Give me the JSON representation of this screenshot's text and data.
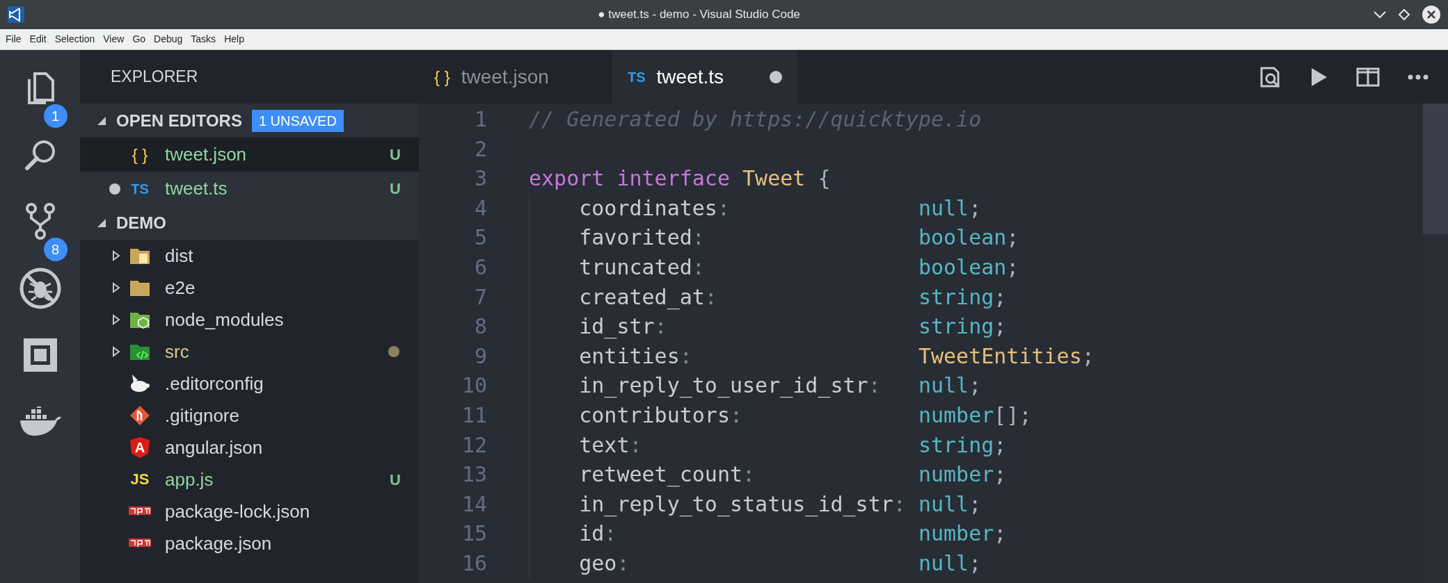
{
  "window": {
    "title": "● tweet.ts - demo - Visual Studio Code"
  },
  "menu": [
    "File",
    "Edit",
    "Selection",
    "View",
    "Go",
    "Debug",
    "Tasks",
    "Help"
  ],
  "activity_bar": [
    {
      "kind": "files",
      "badge": "1"
    },
    {
      "kind": "search"
    },
    {
      "kind": "source-control",
      "badge": "8"
    },
    {
      "kind": "no-debug"
    },
    {
      "kind": "extensions"
    },
    {
      "kind": "docker"
    }
  ],
  "sidebar": {
    "title": "EXPLORER",
    "open_editors": {
      "title": "OPEN EDITORS",
      "badge": "1 UNSAVED",
      "expanded": true,
      "items": [
        {
          "name": "tweet.json",
          "kind": "json",
          "icon_text": "{ }",
          "dirty": false,
          "selected": false,
          "status": "U"
        },
        {
          "name": "tweet.ts",
          "kind": "ts",
          "icon_text": "TS",
          "dirty": true,
          "selected": true,
          "status": "U"
        }
      ]
    },
    "project": {
      "title": "DEMO",
      "expanded": true,
      "items": [
        {
          "name": "dist",
          "kind": "folder-dist",
          "expanded": false,
          "modified": false
        },
        {
          "name": "e2e",
          "kind": "folder",
          "expanded": false,
          "modified": false
        },
        {
          "name": "node_modules",
          "kind": "folder-node",
          "expanded": false,
          "modified": false
        },
        {
          "name": "src",
          "kind": "folder-src",
          "expanded": false,
          "modified": true
        },
        {
          "name": ".editorconfig",
          "kind": "editorconfig",
          "modified": false
        },
        {
          "name": ".gitignore",
          "kind": "git",
          "modified": false
        },
        {
          "name": "angular.json",
          "kind": "angular",
          "icon_text": "A",
          "modified": false
        },
        {
          "name": "app.js",
          "kind": "js",
          "icon_text": "JS",
          "modified": false,
          "status": "U"
        },
        {
          "name": "package-lock.json",
          "kind": "npm",
          "modified": false
        },
        {
          "name": "package.json",
          "kind": "npm",
          "modified": false
        }
      ]
    }
  },
  "tabs": [
    {
      "label": "tweet.json",
      "kind": "json",
      "icon_text": "{ }",
      "selected": false,
      "dirty": false
    },
    {
      "label": "tweet.ts",
      "kind": "ts",
      "icon_text": "TS",
      "selected": true,
      "dirty": true
    }
  ],
  "editor": {
    "lines": [
      {
        "number": "1",
        "kind": "plain",
        "tokens": [
          {
            "kind": "comment",
            "text": "// Generated by https://quicktype.io"
          }
        ]
      },
      {
        "number": "2",
        "kind": "blank"
      },
      {
        "number": "3",
        "kind": "plain",
        "tokens": [
          {
            "kind": "keyword",
            "text": "export"
          },
          {
            "kind": "keyword",
            "text": "interface"
          },
          {
            "kind": "class",
            "text": "Tweet"
          },
          {
            "kind": "punct",
            "text": "{"
          }
        ]
      },
      {
        "number": "4",
        "kind": "field",
        "tokens": [
          {
            "kind": "prop",
            "text": "coordinates"
          },
          {
            "kind": "colon",
            "text": ":"
          },
          {
            "kind": "builtin",
            "text": "null"
          },
          {
            "kind": "punct",
            "text": ";"
          }
        ]
      },
      {
        "number": "5",
        "kind": "field",
        "tokens": [
          {
            "kind": "prop",
            "text": "favorited"
          },
          {
            "kind": "colon",
            "text": ":"
          },
          {
            "kind": "builtin",
            "text": "boolean"
          },
          {
            "kind": "punct",
            "text": ";"
          }
        ]
      },
      {
        "number": "6",
        "kind": "field",
        "tokens": [
          {
            "kind": "prop",
            "text": "truncated"
          },
          {
            "kind": "colon",
            "text": ":"
          },
          {
            "kind": "builtin",
            "text": "boolean"
          },
          {
            "kind": "punct",
            "text": ";"
          }
        ]
      },
      {
        "number": "7",
        "kind": "field",
        "tokens": [
          {
            "kind": "prop",
            "text": "created_at"
          },
          {
            "kind": "colon",
            "text": ":"
          },
          {
            "kind": "builtin",
            "text": "string"
          },
          {
            "kind": "punct",
            "text": ";"
          }
        ]
      },
      {
        "number": "8",
        "kind": "field",
        "tokens": [
          {
            "kind": "prop",
            "text": "id_str"
          },
          {
            "kind": "colon",
            "text": ":"
          },
          {
            "kind": "builtin",
            "text": "string"
          },
          {
            "kind": "punct",
            "text": ";"
          }
        ]
      },
      {
        "number": "9",
        "kind": "field",
        "tokens": [
          {
            "kind": "prop",
            "text": "entities"
          },
          {
            "kind": "colon",
            "text": ":"
          },
          {
            "kind": "class",
            "text": "TweetEntities"
          },
          {
            "kind": "punct",
            "text": ";"
          }
        ]
      },
      {
        "number": "10",
        "kind": "field",
        "tokens": [
          {
            "kind": "prop",
            "text": "in_reply_to_user_id_str"
          },
          {
            "kind": "colon",
            "text": ":"
          },
          {
            "kind": "builtin",
            "text": "null"
          },
          {
            "kind": "punct",
            "text": ";"
          }
        ]
      },
      {
        "number": "11",
        "kind": "field",
        "tokens": [
          {
            "kind": "prop",
            "text": "contributors"
          },
          {
            "kind": "colon",
            "text": ":"
          },
          {
            "kind": "builtin",
            "text": "number"
          },
          {
            "kind": "punct",
            "text": "[];"
          }
        ]
      },
      {
        "number": "12",
        "kind": "field",
        "tokens": [
          {
            "kind": "prop",
            "text": "text"
          },
          {
            "kind": "colon",
            "text": ":"
          },
          {
            "kind": "builtin",
            "text": "string"
          },
          {
            "kind": "punct",
            "text": ";"
          }
        ]
      },
      {
        "number": "13",
        "kind": "field",
        "tokens": [
          {
            "kind": "prop",
            "text": "retweet_count"
          },
          {
            "kind": "colon",
            "text": ":"
          },
          {
            "kind": "builtin",
            "text": "number"
          },
          {
            "kind": "punct",
            "text": ";"
          }
        ]
      },
      {
        "number": "14",
        "kind": "field",
        "tokens": [
          {
            "kind": "prop",
            "text": "in_reply_to_status_id_str"
          },
          {
            "kind": "colon",
            "text": ":"
          },
          {
            "kind": "builtin",
            "text": "null"
          },
          {
            "kind": "punct",
            "text": ";"
          }
        ]
      },
      {
        "number": "15",
        "kind": "field",
        "tokens": [
          {
            "kind": "prop",
            "text": "id"
          },
          {
            "kind": "colon",
            "text": ":"
          },
          {
            "kind": "builtin",
            "text": "number"
          },
          {
            "kind": "punct",
            "text": ";"
          }
        ]
      },
      {
        "number": "16",
        "kind": "field",
        "tokens": [
          {
            "kind": "prop",
            "text": "geo"
          },
          {
            "kind": "colon",
            "text": ":"
          },
          {
            "kind": "builtin",
            "text": "null"
          },
          {
            "kind": "punct",
            "text": ";"
          }
        ]
      }
    ]
  }
}
